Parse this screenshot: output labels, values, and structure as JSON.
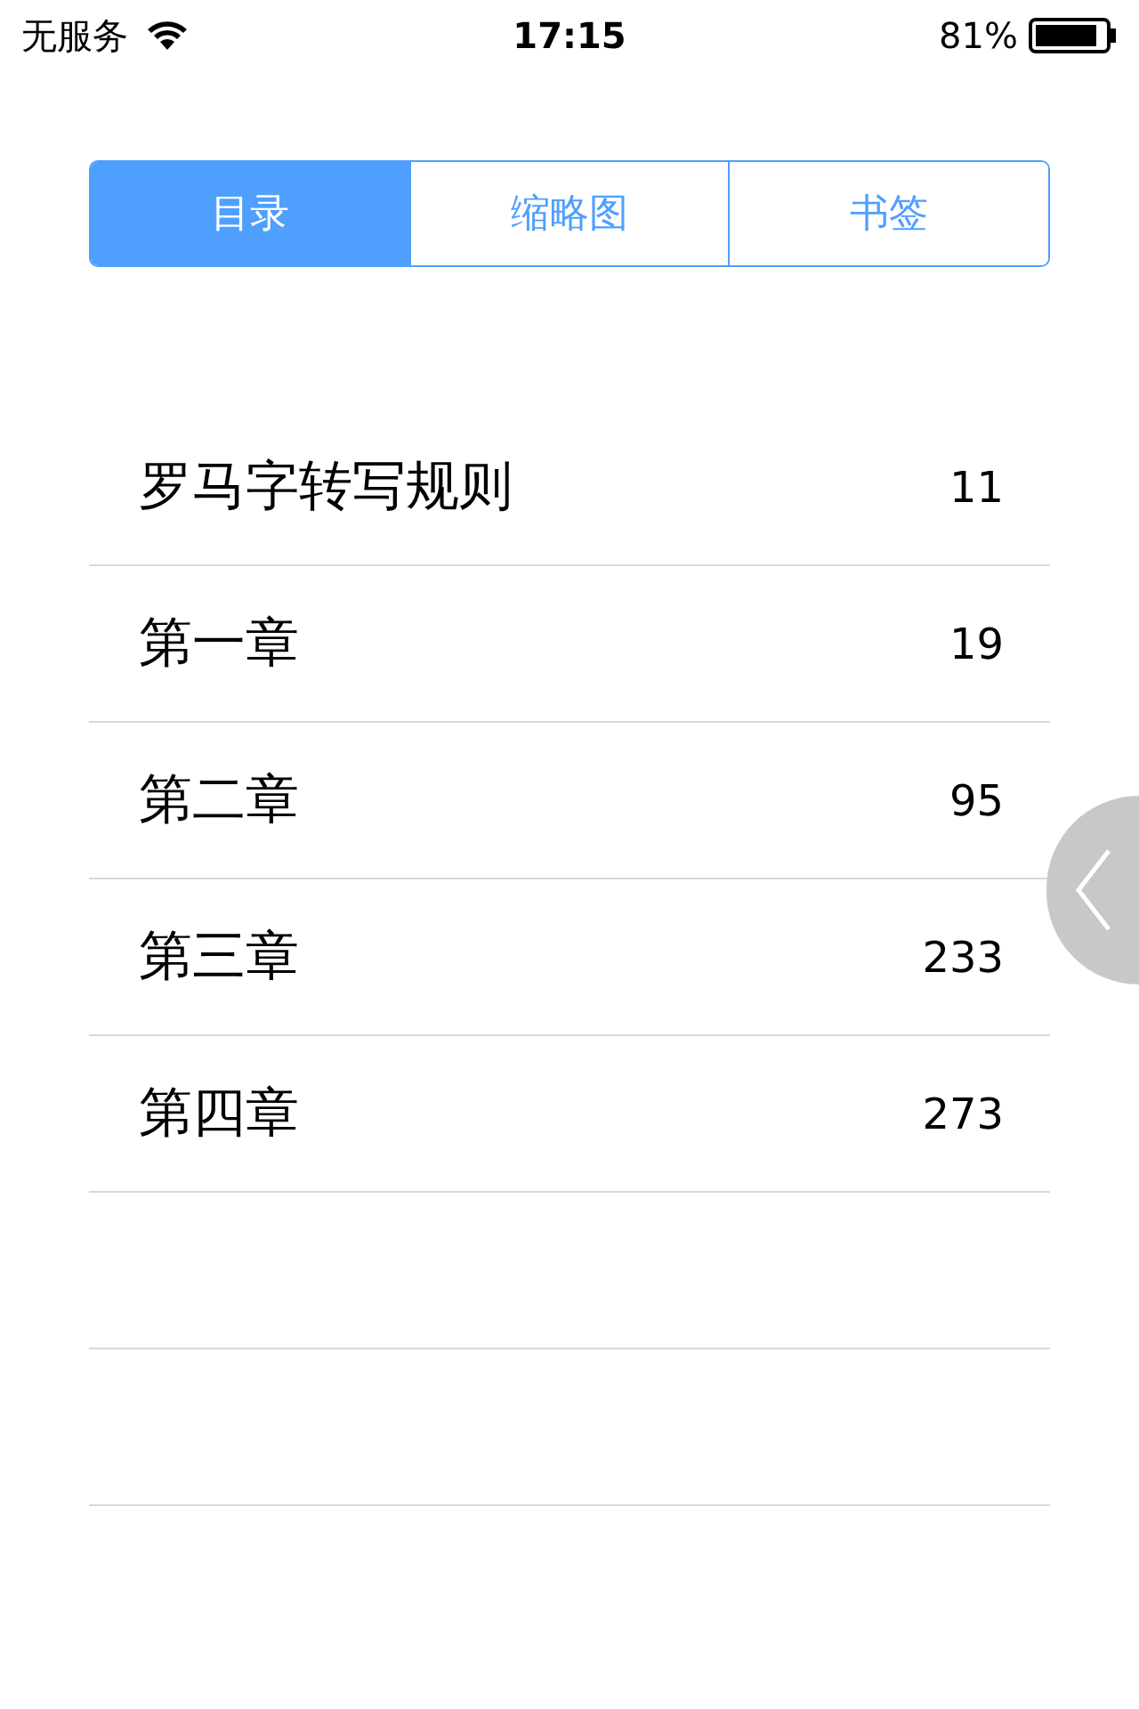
{
  "status_bar": {
    "carrier": "无服务",
    "time": "17:15",
    "battery": "81%"
  },
  "tabs": [
    {
      "label": "目录",
      "selected": true
    },
    {
      "label": "缩略图",
      "selected": false
    },
    {
      "label": "书签",
      "selected": false
    }
  ],
  "contents": [
    {
      "title": "罗马字转写规则",
      "page": "11"
    },
    {
      "title": "第一章",
      "page": "19"
    },
    {
      "title": "第二章",
      "page": "95"
    },
    {
      "title": "第三章",
      "page": "233"
    },
    {
      "title": "第四章",
      "page": "273"
    }
  ]
}
